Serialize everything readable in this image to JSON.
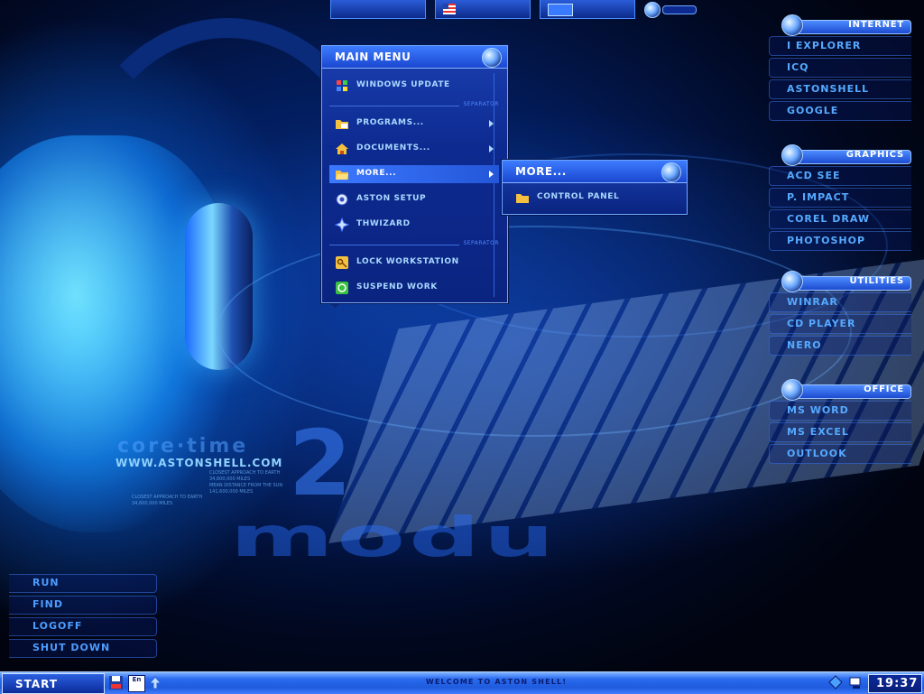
{
  "wallpaper": {
    "logo_text": "core·time",
    "url": "WWW.ASTONSHELL.COM",
    "big_number": "2",
    "big_word": "modu",
    "fine_print": [
      "CLOSEST APPROACH TO EARTH",
      "34,600,000 MILES",
      "MEAN DISTANCE FROM THE SUN",
      "141,600,000 MILES"
    ],
    "fine_print_left": [
      "CLOSEST APPROACH TO EARTH",
      "34,600,000 MILES"
    ]
  },
  "main_menu": {
    "title": "MAIN MENU",
    "items": [
      {
        "label": "WINDOWS UPDATE",
        "icon": "windows-update-icon",
        "arrow": false
      },
      {
        "label": "PROGRAMS...",
        "icon": "programs-folder-icon",
        "arrow": true
      },
      {
        "label": "DOCUMENTS...",
        "icon": "documents-house-icon",
        "arrow": true
      },
      {
        "label": "MORE...",
        "icon": "open-folder-icon",
        "arrow": true,
        "selected": true
      },
      {
        "label": "ASTON SETUP",
        "icon": "setup-gear-icon",
        "arrow": false
      },
      {
        "label": "THWIZARD",
        "icon": "wizard-star-icon",
        "arrow": false
      },
      {
        "label": "LOCK WORKSTATION",
        "icon": "key-icon",
        "arrow": false
      },
      {
        "label": "SUSPEND WORK",
        "icon": "suspend-icon",
        "arrow": false
      }
    ],
    "separator_label": "SEPARATOR"
  },
  "submenu": {
    "title": "MORE...",
    "items": [
      {
        "label": "CONTROL PANEL",
        "icon": "folder-icon"
      }
    ]
  },
  "panels": [
    {
      "title": "INTERNET",
      "items": [
        "I EXPLORER",
        "ICQ",
        "ASTONSHELL",
        "GOOGLE"
      ]
    },
    {
      "title": "GRAPHICS",
      "items": [
        "ACD SEE",
        "P. IMPACT",
        "COREL DRAW",
        "PHOTOSHOP"
      ]
    },
    {
      "title": "UTILITIES",
      "items": [
        "WINRAR",
        "CD PLAYER",
        "NERO"
      ]
    },
    {
      "title": "OFFICE",
      "items": [
        "MS WORD",
        "MS EXCEL",
        "OUTLOOK"
      ]
    }
  ],
  "commands": [
    "RUN",
    "FIND",
    "LOGOFF",
    "SHUT DOWN"
  ],
  "taskbar": {
    "start_label": "START",
    "welcome": "WELCOME TO ASTON SHELL!",
    "clock": "19:37",
    "lang": "En"
  },
  "colors": {
    "accent": "#2a5cd8",
    "text": "#55aaff",
    "taskbar": "#2a6bf0"
  }
}
